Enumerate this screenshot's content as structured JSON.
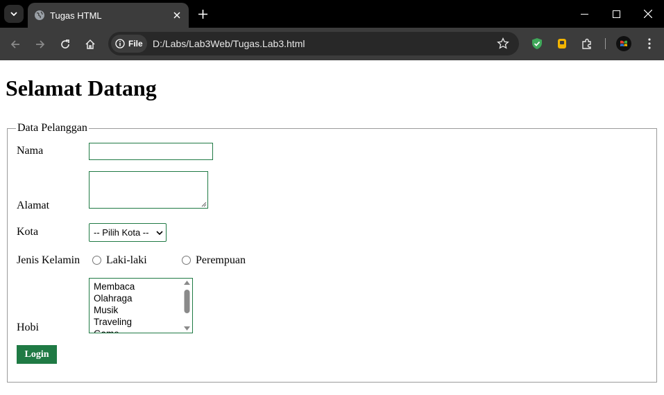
{
  "browser": {
    "tab_title": "Tugas HTML",
    "address_chip": "File",
    "url": "D:/Labs/Lab3Web/Tugas.Lab3.html"
  },
  "page": {
    "heading": "Selamat Datang",
    "fieldset_legend": "Data Pelanggan",
    "form": {
      "nama_label": "Nama",
      "nama_value": "",
      "alamat_label": "Alamat",
      "alamat_value": "",
      "kota_label": "Kota",
      "kota_selected": "-- Pilih Kota --",
      "gender_label": "Jenis Kelamin",
      "gender_options": [
        "Laki-laki",
        "Perempuan"
      ],
      "hobi_label": "Hobi",
      "hobi_options": [
        "Membaca",
        "Olahraga",
        "Musik",
        "Traveling",
        "Game"
      ],
      "login_label": "Login"
    }
  },
  "colors": {
    "accent_green": "#1f7a44",
    "chrome_dark": "#3c3c3c"
  }
}
